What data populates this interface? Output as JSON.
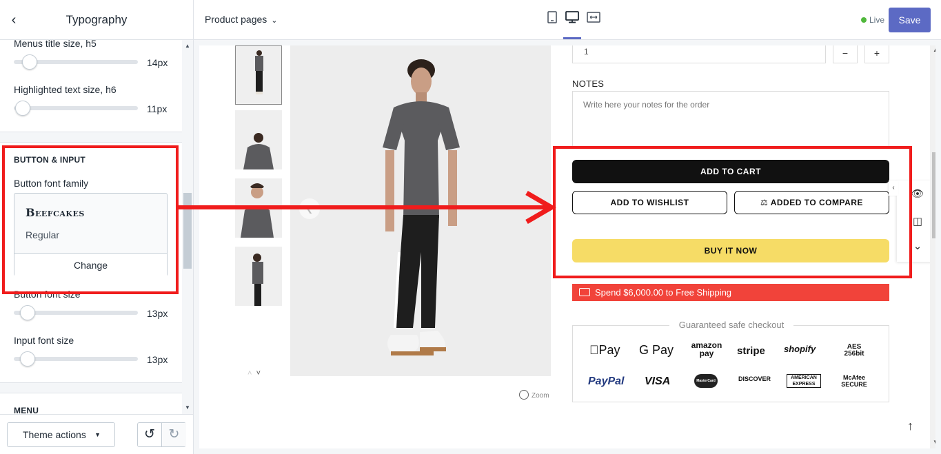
{
  "sidebar": {
    "title": "Typography",
    "settings": [
      {
        "label": "Menus title size, h5",
        "value": "14px"
      },
      {
        "label": "Highlighted text size, h6",
        "value": "11px"
      }
    ],
    "button_input": {
      "section_title": "BUTTON & INPUT",
      "font_family_label": "Button font family",
      "font_name": "Beefcakes",
      "font_style": "Regular",
      "change_label": "Change",
      "font_size_label": "Button font size",
      "font_size_value": "13px",
      "input_size_label": "Input font size",
      "input_size_value": "13px"
    },
    "menu_section_title": "MENU",
    "theme_actions_label": "Theme actions"
  },
  "topbar": {
    "page_select": "Product pages",
    "status": "Live",
    "save_label": "Save"
  },
  "product": {
    "quantity": "1",
    "minus": "−",
    "plus": "+",
    "notes_label": "NOTES",
    "notes_placeholder": "Write here your notes for the order",
    "add_to_cart": "ADD TO CART",
    "add_to_wishlist": "ADD TO WISHLIST",
    "added_to_compare": "ADDED TO COMPARE",
    "buy_it_now": "BUY IT NOW",
    "shipping_text": "Spend $6,000.00 to Free Shipping",
    "zoom_label": "Zoom",
    "trust_title": "Guaranteed safe checkout",
    "payments_row1": [
      "Pay",
      "G Pay",
      "amazon pay",
      "stripe",
      "shopify",
      "AES 256bit"
    ],
    "payments_row2": [
      "PayPal",
      "VISA",
      "MasterCard",
      "DISCOVER",
      "AMERICAN EXPRESS",
      "McAfee SECURE"
    ]
  },
  "colors": {
    "accent": "#5c6ac4",
    "annotation": "#f01c1c",
    "buy_now": "#f6dc66",
    "shipping": "#f1433a"
  }
}
